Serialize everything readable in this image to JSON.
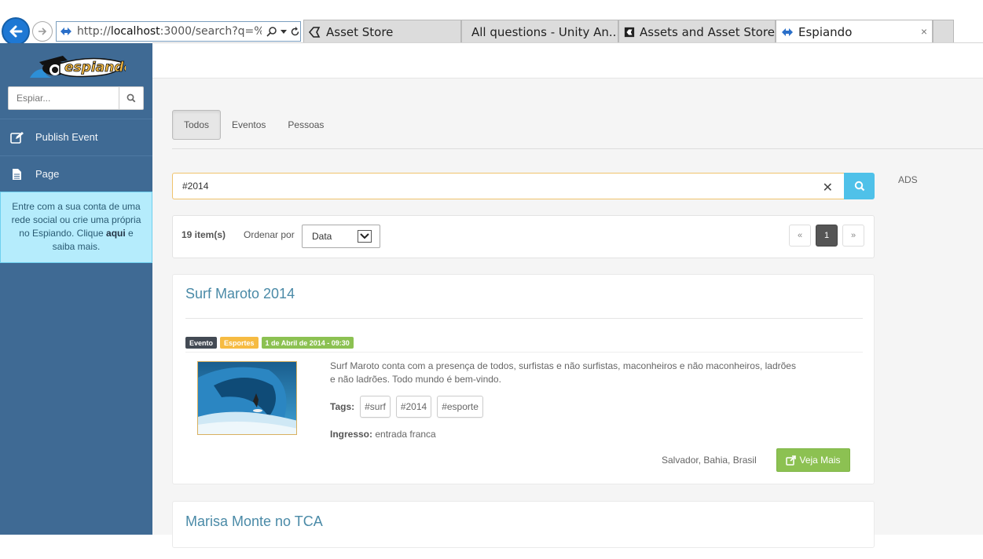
{
  "browser": {
    "url_prefix": "http://",
    "url_host": "localhost",
    "url_rest": ":3000/search?q=%",
    "tabs": [
      {
        "label": "Asset Store"
      },
      {
        "label": "All questions - Unity An..."
      },
      {
        "label": "Assets and Asset Store"
      },
      {
        "label": "Espiando",
        "close": "×"
      }
    ]
  },
  "sidebar": {
    "logo_text": "espiando",
    "search_placeholder": "Espiar...",
    "items": [
      {
        "label": "Publish Event",
        "icon": "edit-icon"
      },
      {
        "label": "Page",
        "icon": "file-icon"
      }
    ],
    "login": {
      "text_before": "Entre com a sua conta de uma rede social ou crie uma própria no Espiando. Clique ",
      "bold": "aqui",
      "text_after": " e saiba mais."
    }
  },
  "filters": {
    "tabs": [
      {
        "label": "Todos",
        "active": true
      },
      {
        "label": "Eventos"
      },
      {
        "label": "Pessoas"
      }
    ]
  },
  "search": {
    "value": "#2014",
    "clear": "✕"
  },
  "ads_label": "ADS",
  "results": {
    "count": "19 item(s)",
    "sort_label": "Ordenar por",
    "sort_value": "Data",
    "pager": {
      "prev": "«",
      "current": "1",
      "next": "»"
    }
  },
  "cards": [
    {
      "title": "Surf Maroto 2014",
      "badges": [
        {
          "label": "Evento",
          "color": "#434a54"
        },
        {
          "label": "Esportes",
          "color": "#f6bb42"
        },
        {
          "label": "1 de Abril de 2014 - 09:30",
          "color": "#8cc152"
        }
      ],
      "description": "Surf Maroto conta com a presença de todos, surfistas e não surfistas, maconheiros e não maconheiros, ladrões e não ladrões. Todo mundo é bem-vindo.",
      "tags_label": "Tags:",
      "tags": [
        "#surf",
        "#2014",
        "#esporte"
      ],
      "entry_label": "Ingresso:",
      "entry_value": " entrada franca",
      "location": "Salvador, Bahia, Brasil",
      "more_label": "Veja Mais"
    },
    {
      "title": "Marisa Monte no TCA"
    }
  ],
  "colors": {
    "sidebar": "#3f6a94",
    "accent_blue": "#4fc1e9",
    "title": "#4a8aa7",
    "green": "#8cc152"
  }
}
